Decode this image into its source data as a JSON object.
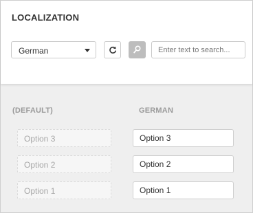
{
  "header": {
    "title": "LOCALIZATION",
    "language_select": {
      "value": "German"
    },
    "reset_icon": "refresh-icon",
    "search_icon": "search-icon",
    "search": {
      "placeholder": "Enter text to search..."
    }
  },
  "columns": {
    "default_heading": "(DEFAULT)",
    "translation_heading": "GERMAN"
  },
  "rows": [
    {
      "default": "Option 3",
      "translation": "Option 3"
    },
    {
      "default": "Option 2",
      "translation": "Option 2"
    },
    {
      "default": "Option 1",
      "translation": "Option 1"
    }
  ]
}
